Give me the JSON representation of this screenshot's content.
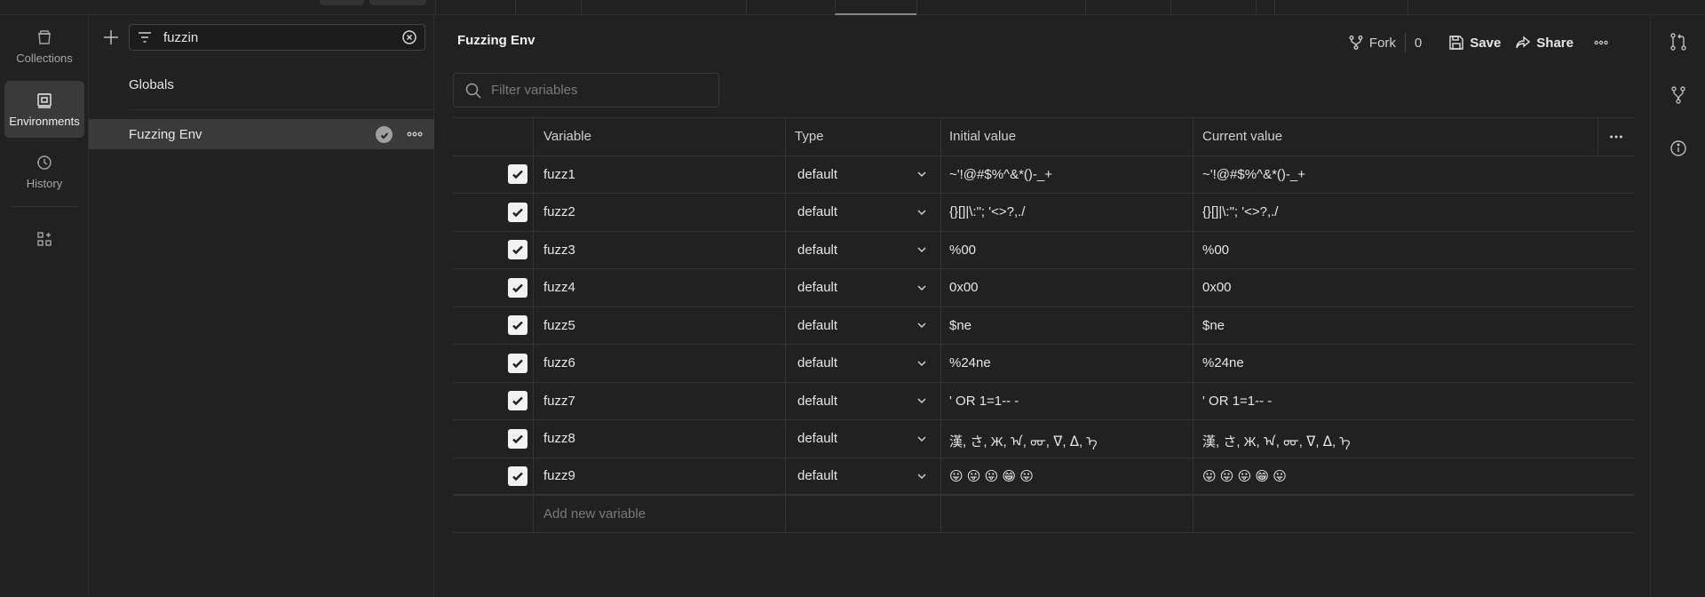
{
  "rail": {
    "items": [
      {
        "label": "Collections",
        "icon": "trash-can-collections-icon"
      },
      {
        "label": "Environments",
        "icon": "environments-icon",
        "active": true
      },
      {
        "label": "History",
        "icon": "history-icon"
      }
    ],
    "extra_icon": "add-widget-icon"
  },
  "sidebar": {
    "search": {
      "value": "fuzzin",
      "placeholder": ""
    },
    "items": [
      {
        "label": "Globals"
      },
      {
        "label": "Fuzzing Env",
        "selected": true
      }
    ]
  },
  "header": {
    "title": "Fuzzing Env",
    "fork_label": "Fork",
    "fork_count": "0",
    "save_label": "Save",
    "share_label": "Share"
  },
  "filter": {
    "placeholder": "Filter variables"
  },
  "table": {
    "columns": {
      "variable": "Variable",
      "type": "Type",
      "initial": "Initial value",
      "current": "Current value"
    },
    "rows": [
      {
        "name": "fuzz1",
        "type": "default",
        "initial": "~'!@#$%^&*()-_+",
        "current": "~'!@#$%^&*()-_+"
      },
      {
        "name": "fuzz2",
        "type": "default",
        "initial": "{}[]|\\:\"; '<>?,./",
        "current": "{}[]|\\:\"; '<>?,./"
      },
      {
        "name": "fuzz3",
        "type": "default",
        "initial": "%00",
        "current": "%00"
      },
      {
        "name": "fuzz4",
        "type": "default",
        "initial": "0x00",
        "current": "0x00"
      },
      {
        "name": "fuzz5",
        "type": "default",
        "initial": "$ne",
        "current": "$ne"
      },
      {
        "name": "fuzz6",
        "type": "default",
        "initial": "%24ne",
        "current": "%24ne"
      },
      {
        "name": "fuzz7",
        "type": "default",
        "initial": "' OR 1=1-- -",
        "current": "' OR 1=1-- -"
      },
      {
        "name": "fuzz8",
        "type": "default",
        "initial": "漢, さ, Ж, ᠠ, ᡂ, ᐁ, ᐃ, ᠡ",
        "current": "漢, さ, Ж, ᠠ, ᡂ, ᐁ, ᐃ, ᠡ"
      },
      {
        "name": "fuzz9",
        "type": "default",
        "initial": "😛 😛 😛 😁 😛",
        "current": "😛 😛 😛 😁 😛"
      }
    ],
    "add_placeholder": "Add new variable"
  },
  "colors": {
    "background": "#212121",
    "selected": "#3a3a3a",
    "border": "#333333"
  }
}
